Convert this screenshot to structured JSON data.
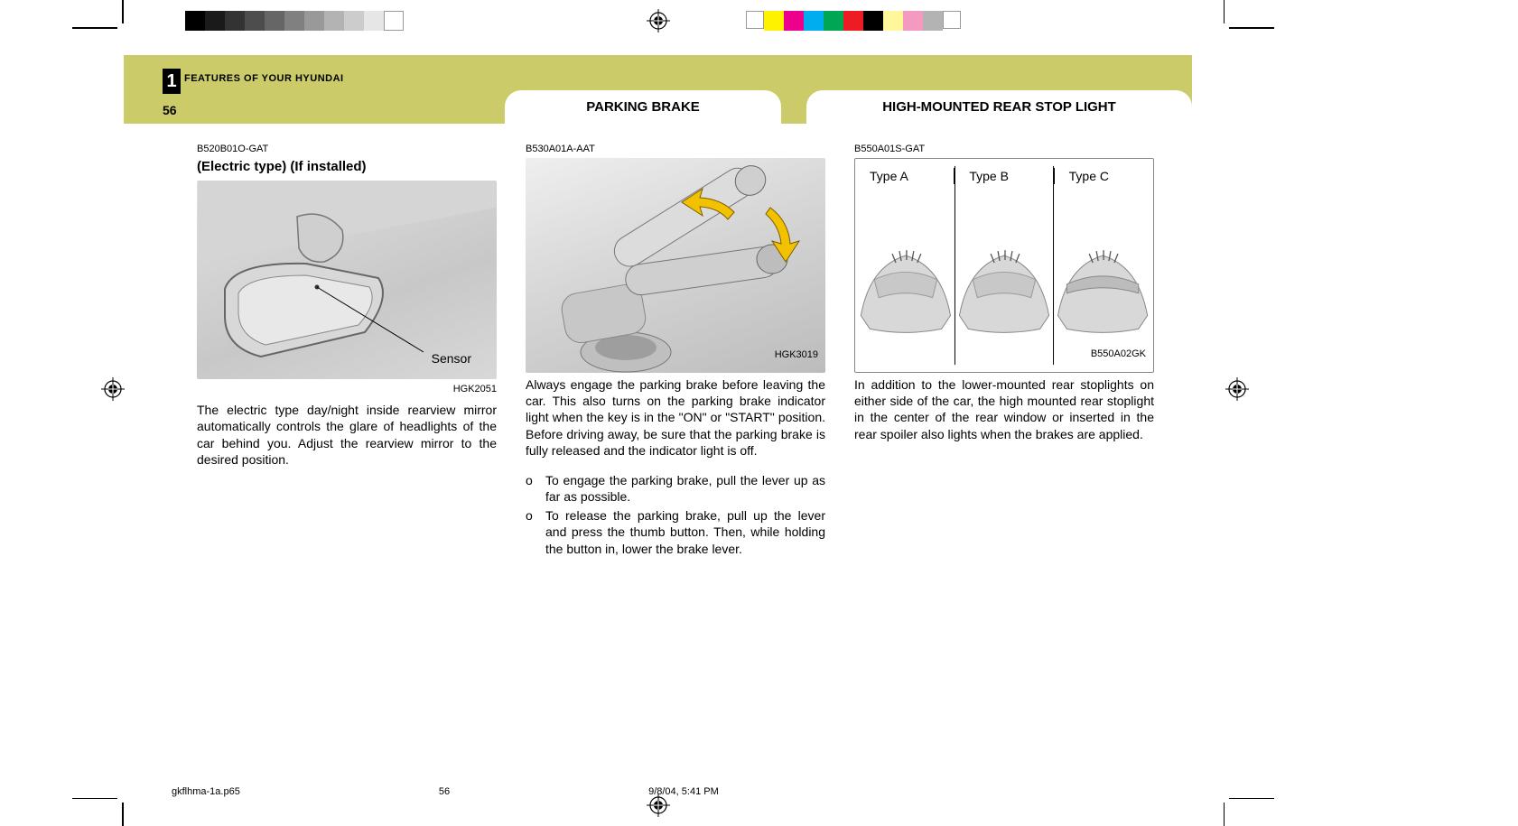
{
  "chapter_number": "1",
  "chapter_title": "FEATURES OF YOUR HYUNDAI",
  "page_number": "56",
  "headers": {
    "parking_brake": "PARKING  BRAKE",
    "rear_stop": "HIGH-MOUNTED REAR STOP LIGHT"
  },
  "col1": {
    "code": "B520B01O-GAT",
    "title": "(Electric type) (If installed)",
    "sensor_label": "Sensor",
    "fig_code": "HGK2051",
    "body": "The electric type day/night inside rearview mirror automatically controls the glare of headlights of the car behind you. Adjust the rearview mirror to the desired position."
  },
  "col2": {
    "code": "B530A01A-AAT",
    "fig_code": "HGK3019",
    "body": "Always engage the parking brake before leaving the car. This also turns on the parking brake indicator light when the key is in the \"ON\" or \"START\" position. Before driving away, be sure that the parking brake is fully released and the indicator light is off.",
    "list": [
      "To engage the parking brake, pull the lever up as far as possible.",
      "To release the parking brake, pull up the lever and press the thumb button. Then, while holding the button in, lower the brake lever."
    ]
  },
  "col3": {
    "code": "B550A01S-GAT",
    "type_a": "Type A",
    "type_b": "Type B",
    "type_c": "Type C",
    "fig_code": "B550A02GK",
    "body": "In addition to the lower-mounted rear stoplights on either side of the car, the high mounted rear stoplight in the center of the rear window or inserted in the rear spoiler also lights when the brakes are applied."
  },
  "footer": {
    "file": "gkflhma-1a.p65",
    "page": "56",
    "datetime": "9/8/04, 5:41 PM"
  },
  "swatches_left": [
    "#000000",
    "#1a1a1a",
    "#333333",
    "#4d4d4d",
    "#666666",
    "#808080",
    "#999999",
    "#b3b3b3",
    "#cccccc",
    "#e6e6e6",
    "#ffffff"
  ],
  "swatches_right": [
    "#fff200",
    "#ec008c",
    "#00aeef",
    "#00a651",
    "#ed1c24",
    "#000000",
    "#fff799",
    "#f49ac1",
    "#b3b3b3"
  ]
}
